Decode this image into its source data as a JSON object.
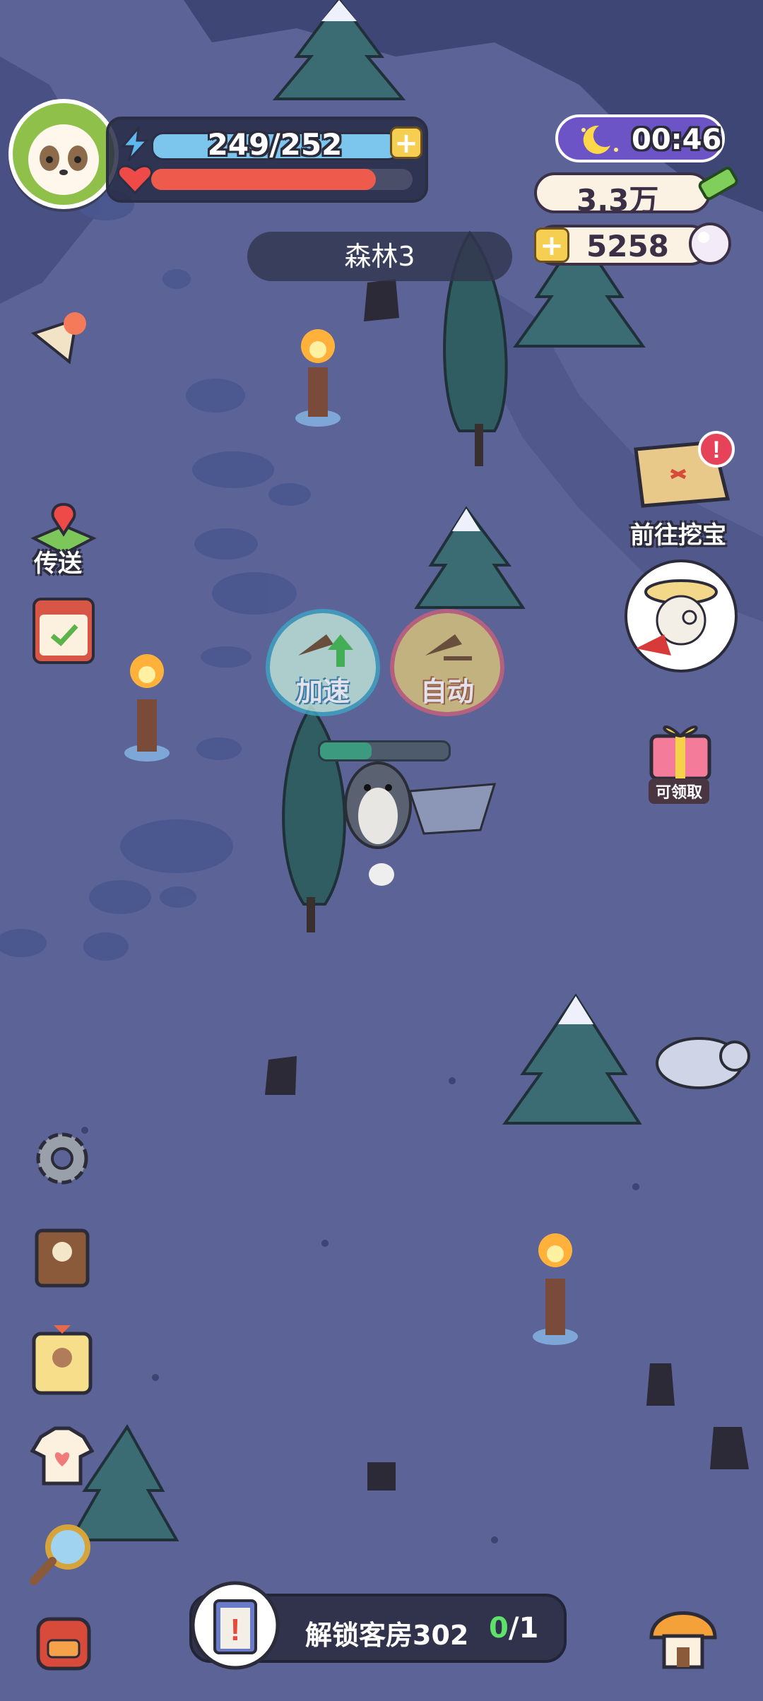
{
  "status": {
    "energy_text": "249/252",
    "energy_fraction": 0.988,
    "health_fraction": 0.86
  },
  "topright": {
    "timer": "00:46",
    "currency_primary": "3.3万",
    "currency_secondary": "5258"
  },
  "location": {
    "name": "森林3"
  },
  "left_menu": {
    "teleport_label": "传送"
  },
  "right_menu": {
    "treasure_label": "前往挖宝",
    "gift_label": "可领取"
  },
  "actions": {
    "speed_label": "加速",
    "auto_label": "自动",
    "work_progress": 0.4
  },
  "task": {
    "label": "解锁客房302",
    "done": "0",
    "total": "/1"
  },
  "colors": {
    "ground": "#5b6397",
    "energy": "#7cc6ee",
    "health": "#ee5a4c",
    "clock_bg": "#6c54c7",
    "progress": "#3c9a7f"
  }
}
